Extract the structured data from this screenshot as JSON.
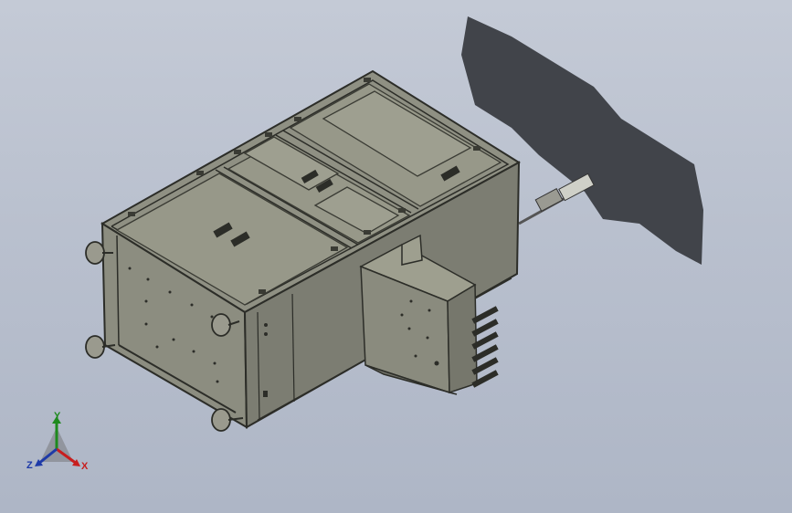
{
  "viewport": {
    "background_top": "#c4cad6",
    "background_bottom": "#aeb6c6",
    "model_color": "#8a8b7e",
    "edge_color": "#2c2d28",
    "shadow_color": "#3a3d42"
  },
  "triad": {
    "x_label": "X",
    "y_label": "Y",
    "z_label": "Z",
    "x_color": "#c81e1e",
    "y_color": "#1e8a1e",
    "z_color": "#1e3aa8"
  }
}
